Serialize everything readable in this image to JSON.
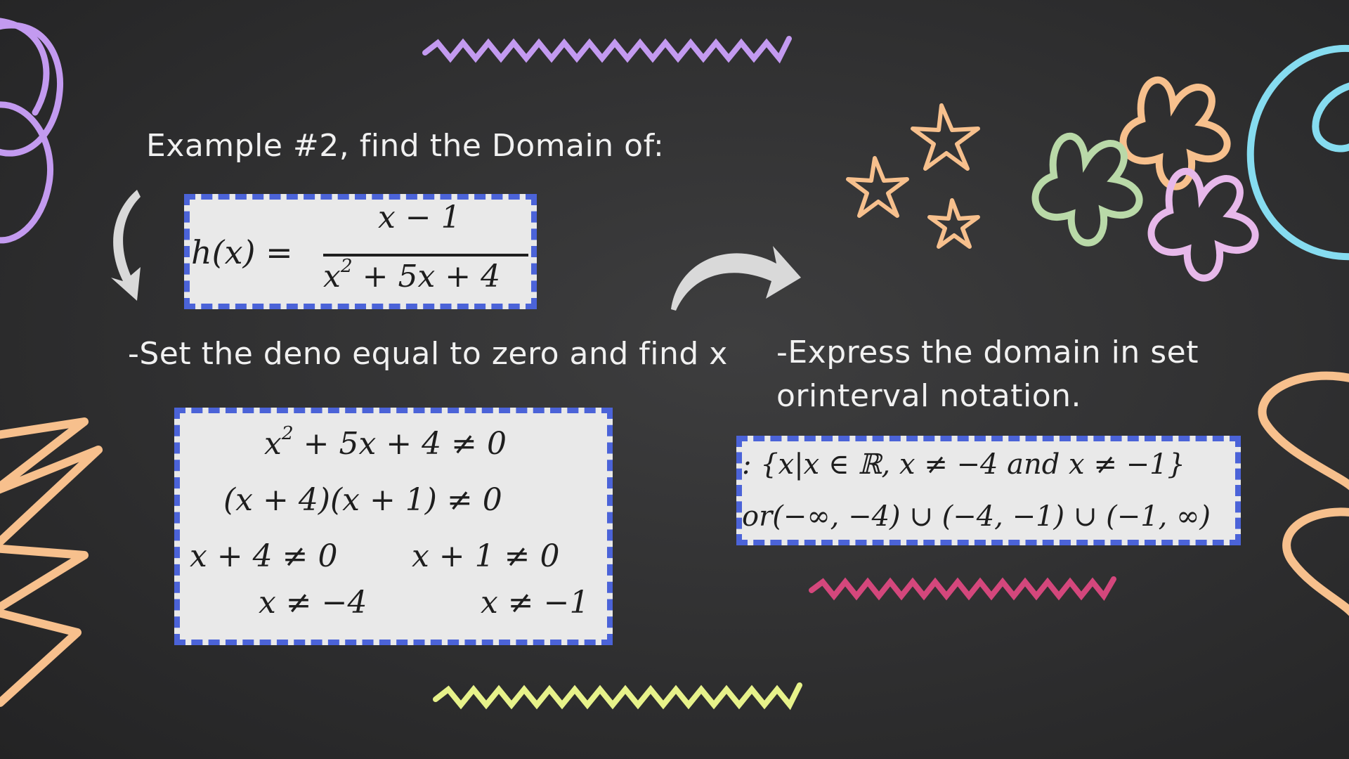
{
  "slide": {
    "heading": "Example #2, find the Domain of:",
    "step1": "-Set the deno equal to zero and find x",
    "step2_line1": "-Express the domain in set",
    "step2_line2": "orinterval notation."
  },
  "function_box": {
    "lhs": "h(x) =",
    "numerator": "x − 1",
    "denominator_x": "x",
    "denominator_exp": "2",
    "denominator_rest": " + 5x + 4"
  },
  "work_box": {
    "line1_x": "x",
    "line1_exp": "2",
    "line1_rest": " + 5x + 4 ≠ 0",
    "line2": "(x + 4)(x + 1) ≠ 0",
    "line3_left": "x + 4 ≠ 0",
    "line3_right": "x + 1 ≠ 0",
    "line4_left": "x ≠ −4",
    "line4_right": "x ≠ −1"
  },
  "answer_box": {
    "set_notation": ": {x|x ∈ ℝ, x ≠ −4   and   x ≠ −1}",
    "interval_notation": "or(−∞, −4) ∪ (−4, −1) ∪ (−1, ∞)"
  },
  "colors": {
    "box_border": "#4b63d8",
    "purple": "#c39af0",
    "orange": "#f7c08d",
    "cyan": "#86dcf0",
    "green": "#b9d9a8",
    "pink": "#e7b8ea",
    "magenta": "#d4477c",
    "yellow": "#e7f28a",
    "arrow": "#d9d9d9"
  }
}
